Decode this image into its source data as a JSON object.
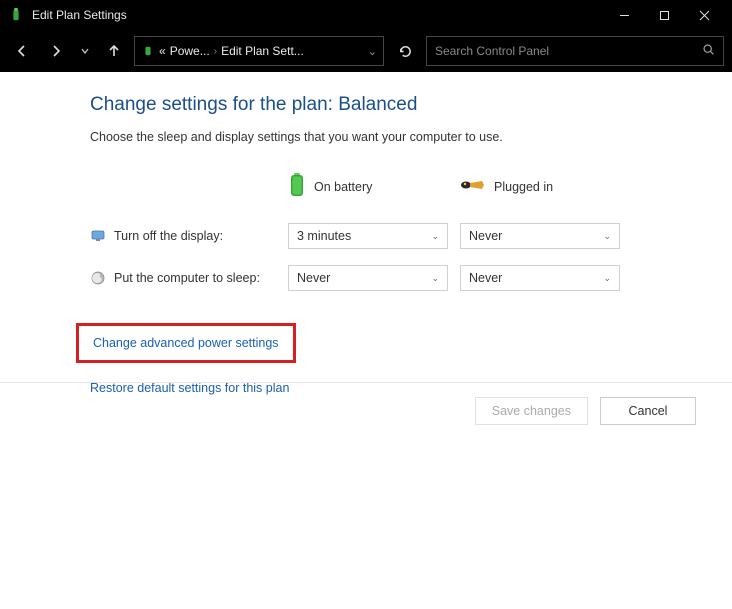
{
  "window": {
    "title": "Edit Plan Settings"
  },
  "breadcrumb": {
    "prefix": "«",
    "item1": "Powe...",
    "item2": "Edit Plan Sett..."
  },
  "search": {
    "placeholder": "Search Control Panel"
  },
  "page": {
    "heading": "Change settings for the plan: Balanced",
    "subtitle": "Choose the sleep and display settings that you want your computer to use."
  },
  "columns": {
    "battery": "On battery",
    "plugged": "Plugged in"
  },
  "rows": {
    "display": {
      "label": "Turn off the display:",
      "battery": "3 minutes",
      "plugged": "Never"
    },
    "sleep": {
      "label": "Put the computer to sleep:",
      "battery": "Never",
      "plugged": "Never"
    }
  },
  "links": {
    "advanced": "Change advanced power settings",
    "restore": "Restore default settings for this plan"
  },
  "buttons": {
    "save": "Save changes",
    "cancel": "Cancel"
  }
}
